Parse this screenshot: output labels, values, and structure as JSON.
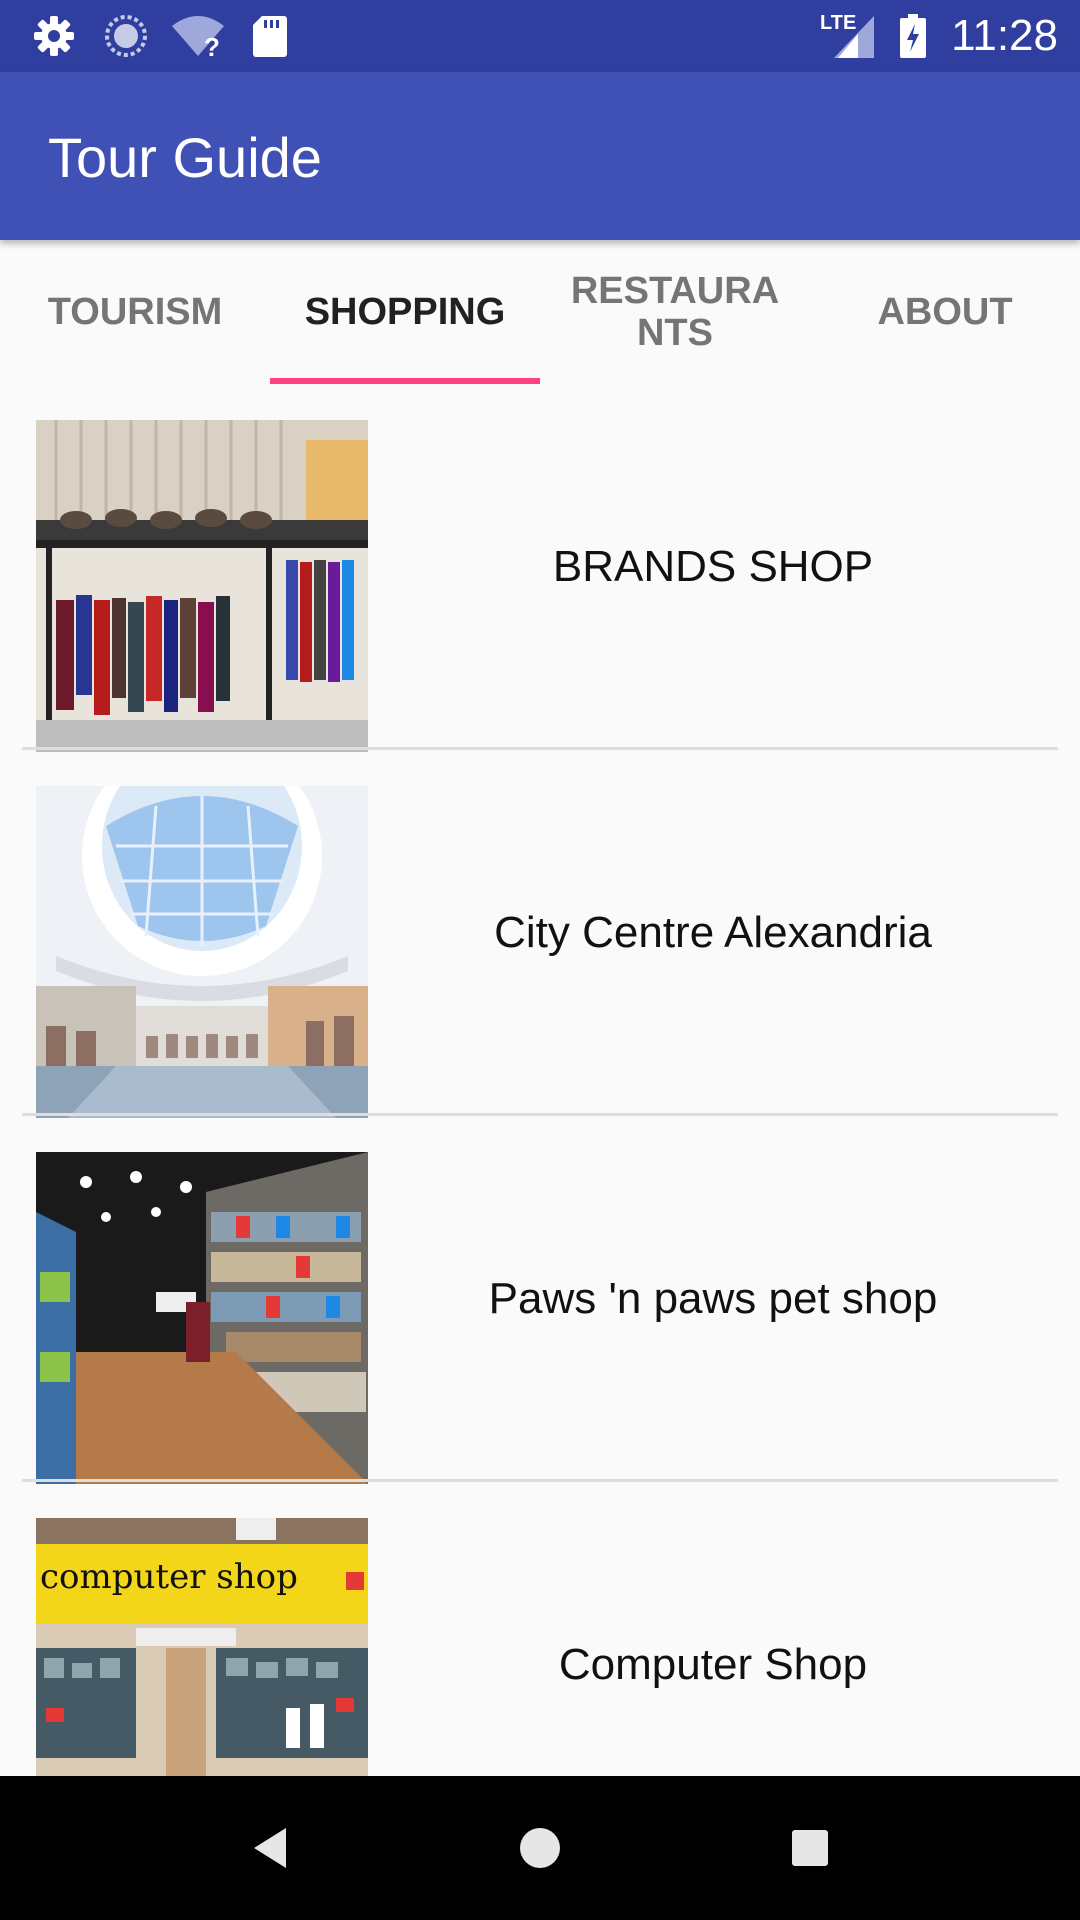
{
  "status_bar": {
    "time": "11:28",
    "network": "LTE",
    "icons": [
      "settings-icon",
      "sync-icon",
      "wifi-unknown-icon",
      "sd-card-icon",
      "signal-icon",
      "battery-charging-icon"
    ]
  },
  "app_bar": {
    "title": "Tour Guide"
  },
  "tabs": [
    {
      "label": "TOURISM",
      "active": false
    },
    {
      "label": "SHOPPING",
      "active": true
    },
    {
      "label": "RESTAURA\nNTS",
      "active": false
    },
    {
      "label": "ABOUT",
      "active": false
    }
  ],
  "colors": {
    "status_bar": "#303f9f",
    "app_bar": "#3f51b5",
    "tab_indicator": "#ff4081",
    "background": "#fafafa"
  },
  "list": {
    "items": [
      {
        "name": "BRANDS SHOP",
        "image": "clothing-store-photo"
      },
      {
        "name": "City Centre Alexandria",
        "image": "mall-interior-photo"
      },
      {
        "name": "Paws 'n paws pet shop",
        "image": "pet-shop-photo"
      },
      {
        "name": "Computer Shop",
        "image": "computer-shop-photo"
      }
    ]
  },
  "nav_bar": {
    "buttons": [
      "back-icon",
      "home-icon",
      "recents-icon"
    ]
  }
}
